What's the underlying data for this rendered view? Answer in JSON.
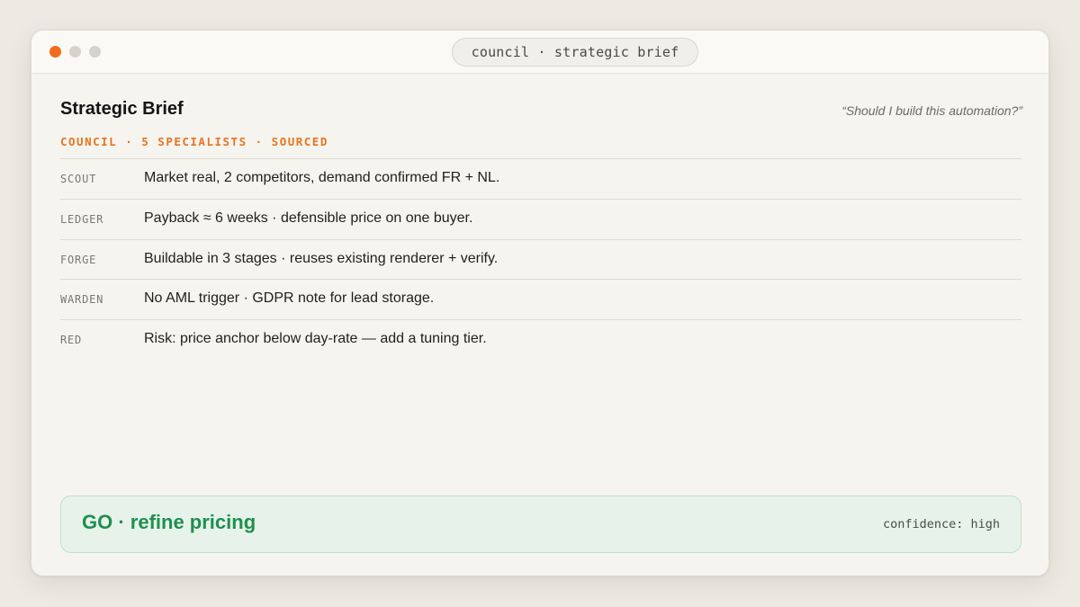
{
  "window": {
    "title": "council · strategic brief"
  },
  "brief": {
    "title": "Strategic Brief",
    "question": "“Should I build this automation?”",
    "meta": "COUNCIL · 5 SPECIALISTS · SOURCED"
  },
  "rows": [
    {
      "label": "SCOUT",
      "text": "Market real, 2 competitors, demand confirmed FR + NL."
    },
    {
      "label": "LEDGER",
      "text": "Payback ≈ 6 weeks · defensible price on one buyer."
    },
    {
      "label": "FORGE",
      "text": "Buildable in 3 stages · reuses existing renderer + verify."
    },
    {
      "label": "WARDEN",
      "text": "No AML trigger · GDPR note for lead storage."
    },
    {
      "label": "RED",
      "text": "Risk: price anchor below day-rate — add a tuning tier."
    }
  ],
  "verdict": {
    "text": "GO · refine pricing",
    "confidence": "confidence: high"
  },
  "colors": {
    "accent": "#e8741f",
    "close_dot": "#f26a1b",
    "verdict_green": "#1f8f4f",
    "verdict_bg": "#e7f3ea"
  }
}
